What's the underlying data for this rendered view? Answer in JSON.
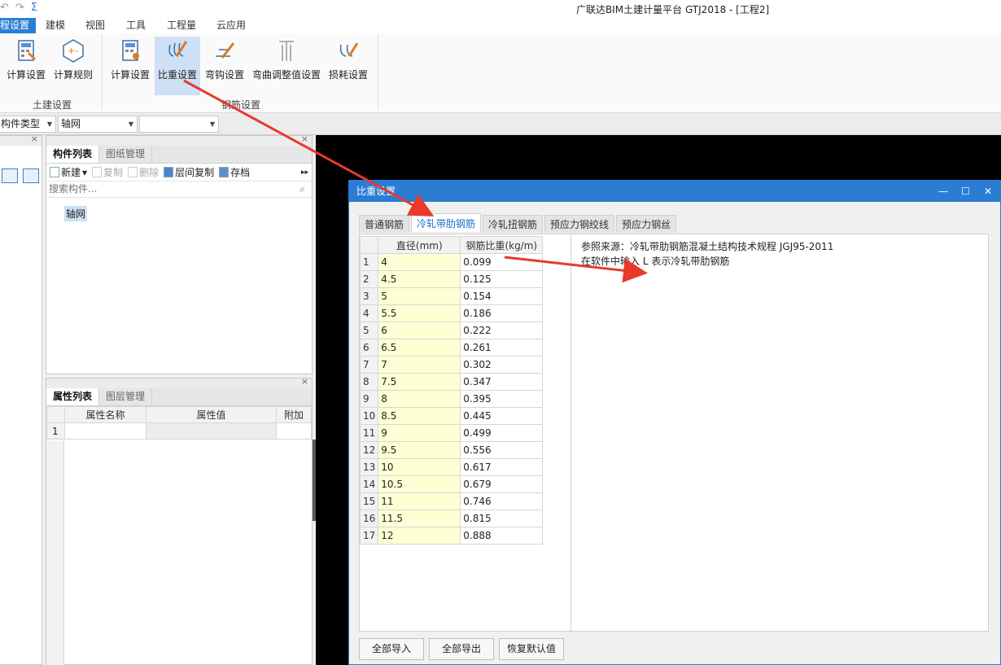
{
  "window": {
    "title": "广联达BIM土建计量平台 GTJ2018 - [工程2]"
  },
  "qat": {
    "undo": "↶",
    "redo": "↷",
    "sum": "Σ"
  },
  "menu": [
    "程设置",
    "建模",
    "视图",
    "工具",
    "工程量",
    "云应用"
  ],
  "ribbon": {
    "group1": {
      "label": "土建设置",
      "buttons": [
        "计算设置",
        "计算规则"
      ]
    },
    "group2": {
      "label": "钢筋设置",
      "buttons": [
        "计算设置",
        "比重设置",
        "弯钩设置",
        "弯曲调整值设置",
        "损耗设置"
      ]
    }
  },
  "combos": {
    "type": "构件类型",
    "axis": "轴网",
    "third": ""
  },
  "component_panel": {
    "tabs": [
      "构件列表",
      "图纸管理"
    ],
    "toolbar": {
      "new": "新建",
      "copy": "复制",
      "delete": "删除",
      "floor_copy": "层间复制",
      "save": "存档"
    },
    "search_placeholder": "搜索构件...",
    "items": [
      "轴网"
    ]
  },
  "property_panel": {
    "tabs": [
      "属性列表",
      "图层管理"
    ],
    "columns": [
      "属性名称",
      "属性值",
      "附加"
    ],
    "rows": [
      "1"
    ]
  },
  "dialog": {
    "title": "比重设置",
    "controls": {
      "min": "—",
      "max": "☐",
      "close": "✕"
    },
    "tabs": [
      "普通钢筋",
      "冷轧带肋钢筋",
      "冷轧扭钢筋",
      "预应力钢绞线",
      "预应力钢丝"
    ],
    "columns": [
      "直径(mm)",
      "钢筋比重(kg/m)"
    ],
    "rows": [
      {
        "n": "1",
        "d": "4",
        "w": "0.099"
      },
      {
        "n": "2",
        "d": "4.5",
        "w": "0.125"
      },
      {
        "n": "3",
        "d": "5",
        "w": "0.154"
      },
      {
        "n": "4",
        "d": "5.5",
        "w": "0.186"
      },
      {
        "n": "5",
        "d": "6",
        "w": "0.222"
      },
      {
        "n": "6",
        "d": "6.5",
        "w": "0.261"
      },
      {
        "n": "7",
        "d": "7",
        "w": "0.302"
      },
      {
        "n": "8",
        "d": "7.5",
        "w": "0.347"
      },
      {
        "n": "9",
        "d": "8",
        "w": "0.395"
      },
      {
        "n": "10",
        "d": "8.5",
        "w": "0.445"
      },
      {
        "n": "11",
        "d": "9",
        "w": "0.499"
      },
      {
        "n": "12",
        "d": "9.5",
        "w": "0.556"
      },
      {
        "n": "13",
        "d": "10",
        "w": "0.617"
      },
      {
        "n": "14",
        "d": "10.5",
        "w": "0.679"
      },
      {
        "n": "15",
        "d": "11",
        "w": "0.746"
      },
      {
        "n": "16",
        "d": "11.5",
        "w": "0.815"
      },
      {
        "n": "17",
        "d": "12",
        "w": "0.888"
      }
    ],
    "note_line1": "参照来源：冷轧带肋钢筋混凝土结构技术规程 JGJ95-2011",
    "note_line2": "在软件中输入 L 表示冷轧带肋钢筋",
    "buttons": [
      "全部导入",
      "全部导出",
      "恢复默认值"
    ]
  },
  "colors": {
    "accent": "#2b7dd4",
    "arrow": "#e8392b",
    "diameter_cell": "#ffffd6"
  }
}
